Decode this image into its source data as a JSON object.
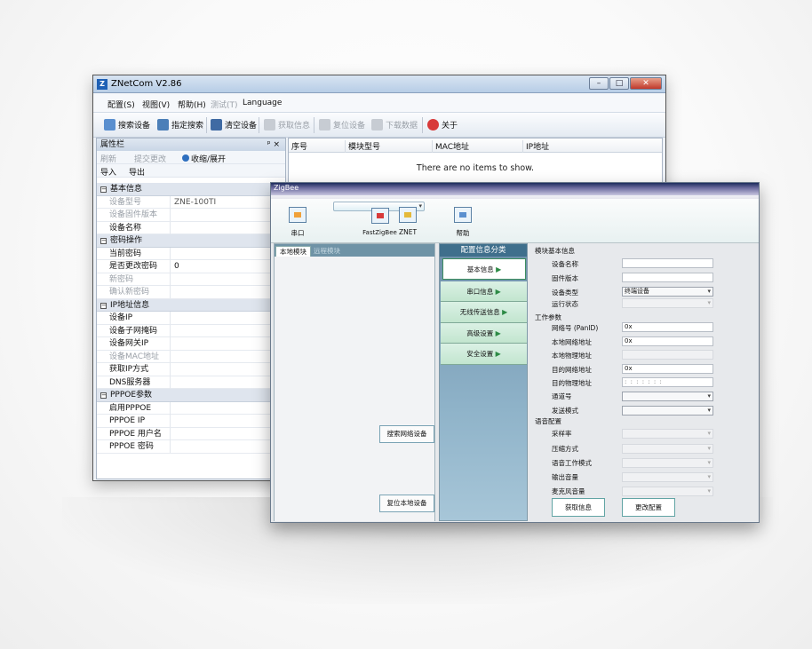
{
  "back_window": {
    "title": "ZNetCom V2.86",
    "menu": [
      "配置(S)",
      "视图(V)",
      "帮助(H)",
      "测试(T)",
      "Language"
    ],
    "toolbar": {
      "search": "搜索设备",
      "specify": "指定搜索",
      "clear": "清空设备",
      "get_info": "获取信息",
      "reset": "复位设备",
      "download": "下载数据",
      "about": "关于"
    },
    "property_panel": {
      "title": "属性栏",
      "pin": "ᵖ ×",
      "refresh": "刷新",
      "submit": "提交更改",
      "collapse": "收缩/展开",
      "import": "导入",
      "export": "导出",
      "groups": [
        {
          "name": "基本信息",
          "rows": [
            {
              "key": "设备型号",
              "value": "ZNE-100TI"
            },
            {
              "key": "设备固件版本",
              "value": ""
            },
            {
              "key": "设备名称",
              "value": ""
            }
          ]
        },
        {
          "name": "密码操作",
          "rows": [
            {
              "key": "当前密码",
              "value": ""
            },
            {
              "key": "是否更改密码",
              "value": "0"
            },
            {
              "key": "新密码",
              "value": ""
            },
            {
              "key": "确认新密码",
              "value": ""
            }
          ]
        },
        {
          "name": "IP地址信息",
          "rows": [
            {
              "key": "设备IP",
              "value": ""
            },
            {
              "key": "设备子网掩码",
              "value": ""
            },
            {
              "key": "设备网关IP",
              "value": ""
            },
            {
              "key": "设备MAC地址",
              "value": ""
            },
            {
              "key": "获取IP方式",
              "value": ""
            },
            {
              "key": "DNS服务器",
              "value": ""
            }
          ]
        },
        {
          "name": "PPPOE参数",
          "rows": [
            {
              "key": "启用PPPOE",
              "value": ""
            },
            {
              "key": "PPPOE IP",
              "value": ""
            },
            {
              "key": "PPPOE 用户名",
              "value": ""
            },
            {
              "key": "PPPOE 密码",
              "value": ""
            }
          ]
        }
      ]
    },
    "list": {
      "columns": [
        "序号",
        "模块型号",
        "MAC地址",
        "IP地址"
      ],
      "empty_text": "There are no items to show."
    }
  },
  "front_window": {
    "title": "ZigBee",
    "ribbon": [
      "串口",
      "FastZigBee",
      "ZNET",
      "帮助"
    ],
    "left_panel": {
      "tabs": [
        "本地模块",
        "远程模块"
      ],
      "search_button": "搜索网络设备",
      "reset_button": "复位本地设备"
    },
    "middle_panel": {
      "title": "配置信息分类",
      "items": [
        "基本信息",
        "串口信息",
        "无线传送信息",
        "高级设置",
        "安全设置"
      ]
    },
    "config": {
      "section_basic": "模块基本信息",
      "device_name": "设备名称",
      "firmware": "固件版本",
      "device_type": "设备类型",
      "device_type_value": "终端设备",
      "run_state": "运行状态",
      "section_work": "工作参数",
      "pan_id": "网络号 (PanID)",
      "pan_id_value": "0x",
      "local_net_addr": "本地网络地址",
      "local_net_value": "0x",
      "local_phys_addr": "本地物理地址",
      "dest_net_addr": "目的网络地址",
      "dest_net_value": "0x",
      "dest_phys_addr": "目的物理地址",
      "dest_phys_value": ": : : : : : :",
      "channel": "通道号",
      "send_mode": "发送模式",
      "section_voice": "语音配置",
      "sample_rate": "采样率",
      "compression": "压缩方式",
      "voice_mode": "语音工作模式",
      "output_volume": "输出音量",
      "mic_volume": "麦克风音量",
      "get_button": "获取信息",
      "modify_button": "更改配置"
    }
  },
  "colors": {
    "accent": "#3f6f8c",
    "nav_green": "#c2e5cf",
    "title_dark": "#1d2c5d"
  }
}
